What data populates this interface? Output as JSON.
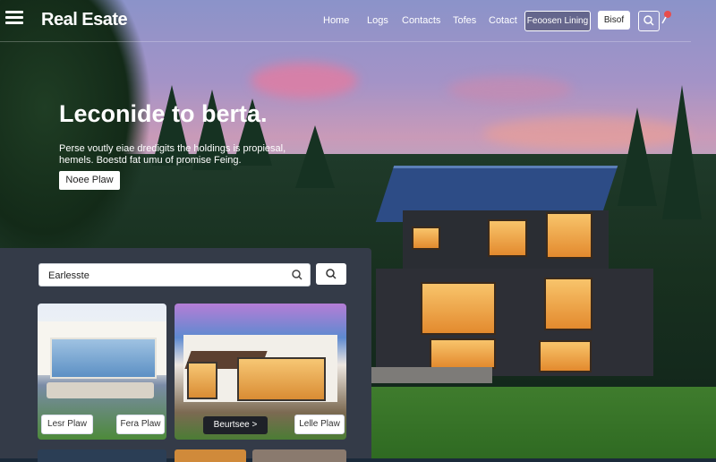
{
  "header": {
    "brand": "Real Esate",
    "nav": [
      "Home",
      "Logs",
      "Contacts",
      "Tofes",
      "Cotact"
    ],
    "cta_outline": "Feoosen Lining",
    "cta_primary": "Bisof"
  },
  "hero": {
    "title": "Leconide to berta.",
    "description": "Perse voutly eiae dredigits the holdings is propiesal, hemels. Boestd fat umu of promise Feing.",
    "button": "Noee Plaw"
  },
  "listings": {
    "search_value": "Earlesste",
    "cards": [
      {
        "button": "Lesr Plaw"
      },
      {
        "buttons": [
          "Fera Plaw",
          "Beurtsee >",
          "Lelle Plaw"
        ]
      }
    ]
  },
  "colors": {
    "panel": "#343b48",
    "accent_orange": "#e38a2e",
    "roof_blue": "#2d4c86"
  }
}
